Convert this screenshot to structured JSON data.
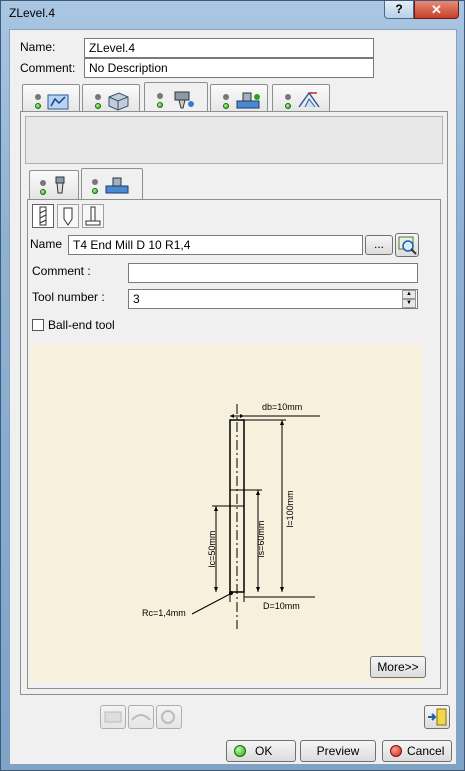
{
  "window": {
    "title": "ZLevel.4",
    "help_label": "?",
    "close_label": "✕"
  },
  "form": {
    "name_label": "Name:",
    "name_value": "ZLevel.4",
    "comment_label": "Comment:",
    "comment_value": "No Description"
  },
  "main_tabs": [
    {
      "icon": "strategy-icon"
    },
    {
      "icon": "geometry-icon"
    },
    {
      "icon": "tool-icon",
      "active": true
    },
    {
      "icon": "feeds-speeds-icon"
    },
    {
      "icon": "macros-icon"
    }
  ],
  "sub_tabs": [
    {
      "icon": "tool-assembly-icon"
    },
    {
      "icon": "tool-tab-icon",
      "active": true
    }
  ],
  "tool": {
    "name_label": "Name",
    "name_value": "T4 End Mill D 10 R1,4",
    "browse_label": "...",
    "comment_label": "Comment :",
    "comment_value": "",
    "tool_number_label": "Tool number :",
    "tool_number_value": "3",
    "ball_end_label": "Ball-end tool",
    "ball_end_checked": false
  },
  "drawing": {
    "db_label": "db=10mm",
    "l_label": "l=100mm",
    "lc_label": "lc=50mm",
    "ls_label": "ls=60mm",
    "rc_label": "Rc=1,4mm",
    "d_label": "D=10mm"
  },
  "more_label": "More>>",
  "bottom_icons": [
    "replay-icon",
    "simulate-icon",
    "analyze-icon"
  ],
  "ok_label": "OK",
  "preview_label": "Preview",
  "cancel_label": "Cancel",
  "colors": {
    "ok_led": "#2ea11c",
    "cancel_led": "#c9271f",
    "drawing_bg": "#f7f0dc"
  }
}
